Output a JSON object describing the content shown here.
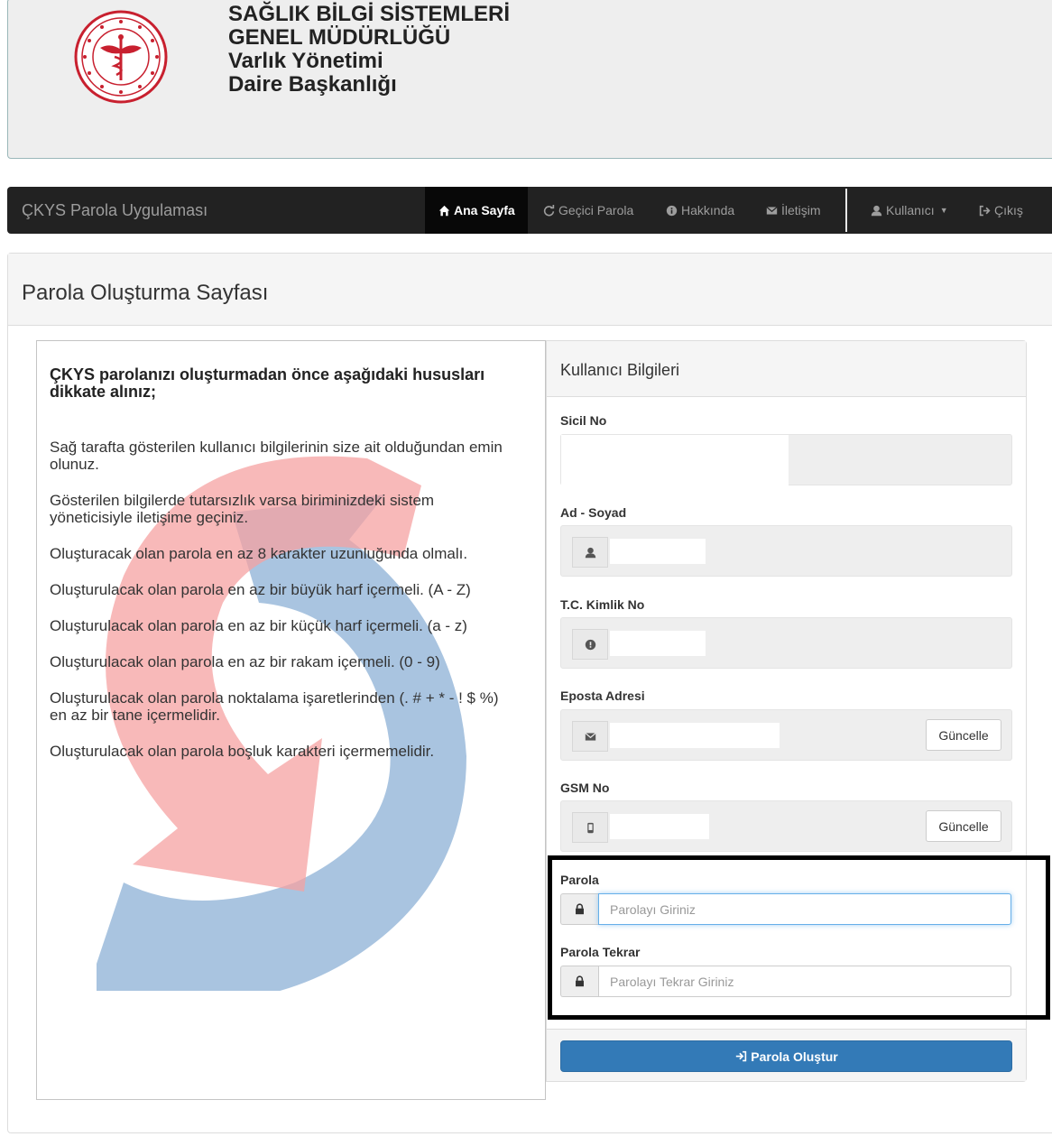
{
  "header": {
    "org_line1": "SAĞLIK BİLGİ SİSTEMLERİ",
    "org_line2": "GENEL MÜDÜRLÜĞÜ",
    "org_line3": "Varlık Yönetimi",
    "org_line4": "Daire Başkanlığı",
    "logo": "ministry-seal"
  },
  "navbar": {
    "brand": "ÇKYS Parola Uygulaması",
    "items": [
      {
        "label": "Ana Sayfa",
        "icon": "home-icon",
        "active": true
      },
      {
        "label": "Geçici Parola",
        "icon": "refresh-icon"
      },
      {
        "label": "Hakkında",
        "icon": "info-icon"
      },
      {
        "label": "İletişim",
        "icon": "envelope-icon"
      },
      {
        "label": "Kullanıcı",
        "icon": "user-icon",
        "dropdown": true
      },
      {
        "label": "Çıkış",
        "icon": "logout-icon"
      }
    ]
  },
  "page": {
    "title": "Parola Oluşturma Sayfası"
  },
  "info": {
    "heading": "ÇKYS parolanızı oluşturmadan önce aşağıdaki hususları dikkate alınız;",
    "items": [
      "Sağ tarafta gösterilen kullanıcı bilgilerinin size ait olduğundan emin olunuz.",
      "Gösterilen bilgilerde tutarsızlık varsa biriminizdeki sistem yöneticisiyle iletişime geçiniz.",
      "Oluşturacak olan parola en az 8 karakter uzunluğunda olmalı.",
      "Oluşturulacak olan parola en az bir büyük harf içermeli. (A - Z)",
      "Oluşturulacak olan parola en az bir küçük harf içermeli. (a - z)",
      "Oluşturulacak olan parola en az bir rakam içermeli. (0 - 9)",
      "Oluşturulacak olan parola noktalama işaretlerinden (. # + * - ! $ %) en az bir tane içermelidir.",
      "Oluşturulacak olan parola boşluk karakteri içermemelidir."
    ]
  },
  "form": {
    "title": "Kullanıcı Bilgileri",
    "sicil_label": "Sicil No",
    "adsoyad_label": "Ad - Soyad",
    "tc_label": "T.C. Kimlik No",
    "eposta_label": "Eposta Adresi",
    "gsm_label": "GSM No",
    "update_label": "Güncelle",
    "parola_label": "Parola",
    "parola_placeholder": "Parolayı Giriniz",
    "parola_tekrar_label": "Parola Tekrar",
    "parola_tekrar_placeholder": "Parolayı Tekrar Giriniz",
    "submit_label": "Parola Oluştur"
  },
  "colors": {
    "navbar_bg": "#222222",
    "primary": "#337ab7",
    "highlight_border": "#000000",
    "logo_red": "#c8202f"
  }
}
